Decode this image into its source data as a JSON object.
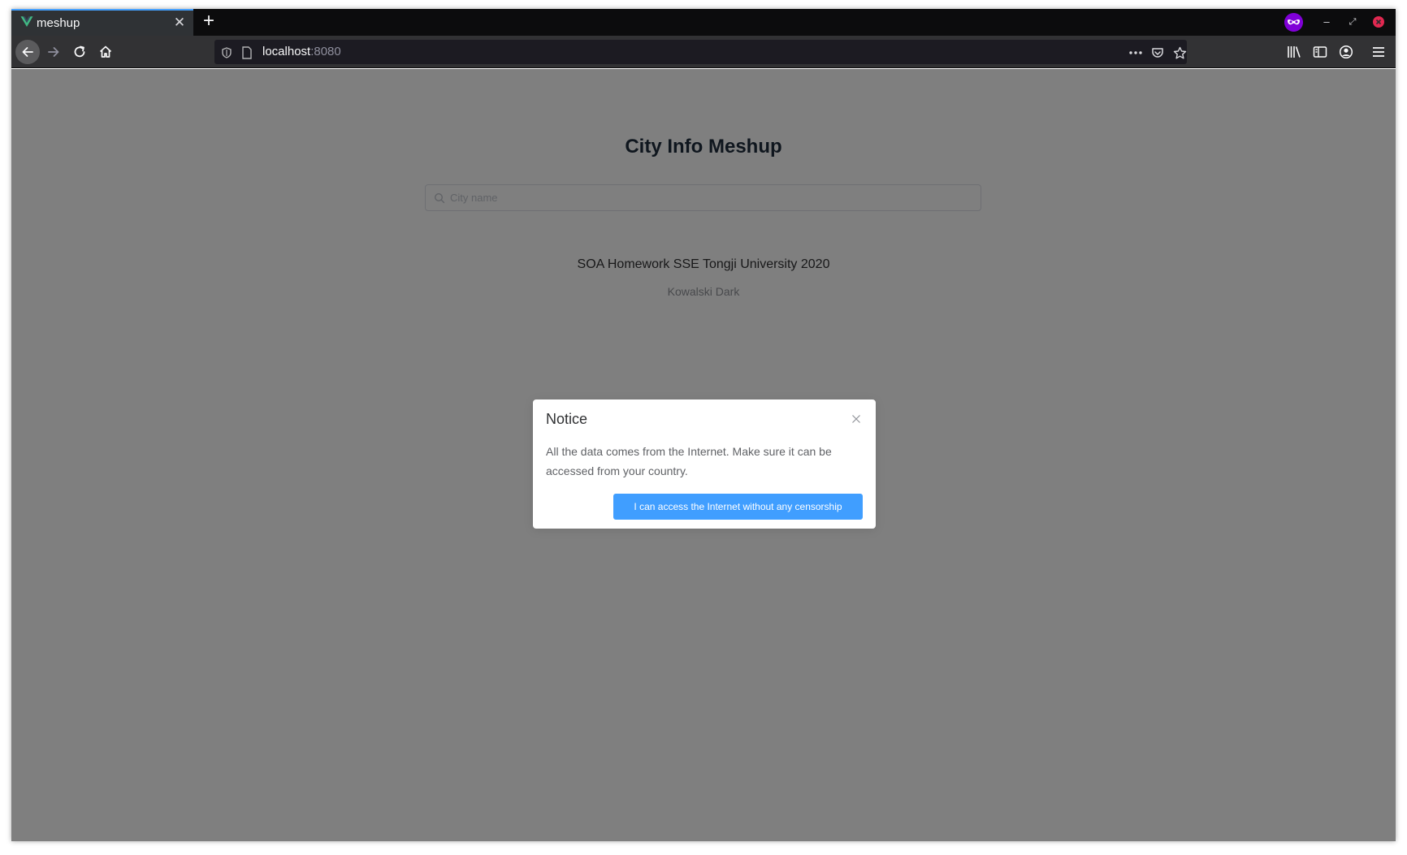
{
  "browser": {
    "tab": {
      "title": "meshup",
      "close_glyph": "✕"
    },
    "new_tab_glyph": "+",
    "url": {
      "host": "localhost",
      "port": ":8080"
    },
    "window_controls": {
      "minimize": "–",
      "restore": "⤢",
      "close": "✕"
    }
  },
  "page": {
    "title": "City Info Meshup",
    "search": {
      "placeholder": "City name",
      "value": ""
    },
    "footer": {
      "line": "SOA Homework SSE Tongji University 2020",
      "author": "Kowalski Dark"
    }
  },
  "dialog": {
    "title": "Notice",
    "message": "All the data comes from the Internet. Make sure it can be accessed from your country.",
    "confirm_label": "I can access the Internet without any censorship"
  },
  "colors": {
    "accent": "#409eff",
    "tab_highlight": "#45a1ff",
    "vue_green": "#41b883",
    "private_mask": "#8000d7",
    "close_red": "#e22850"
  }
}
